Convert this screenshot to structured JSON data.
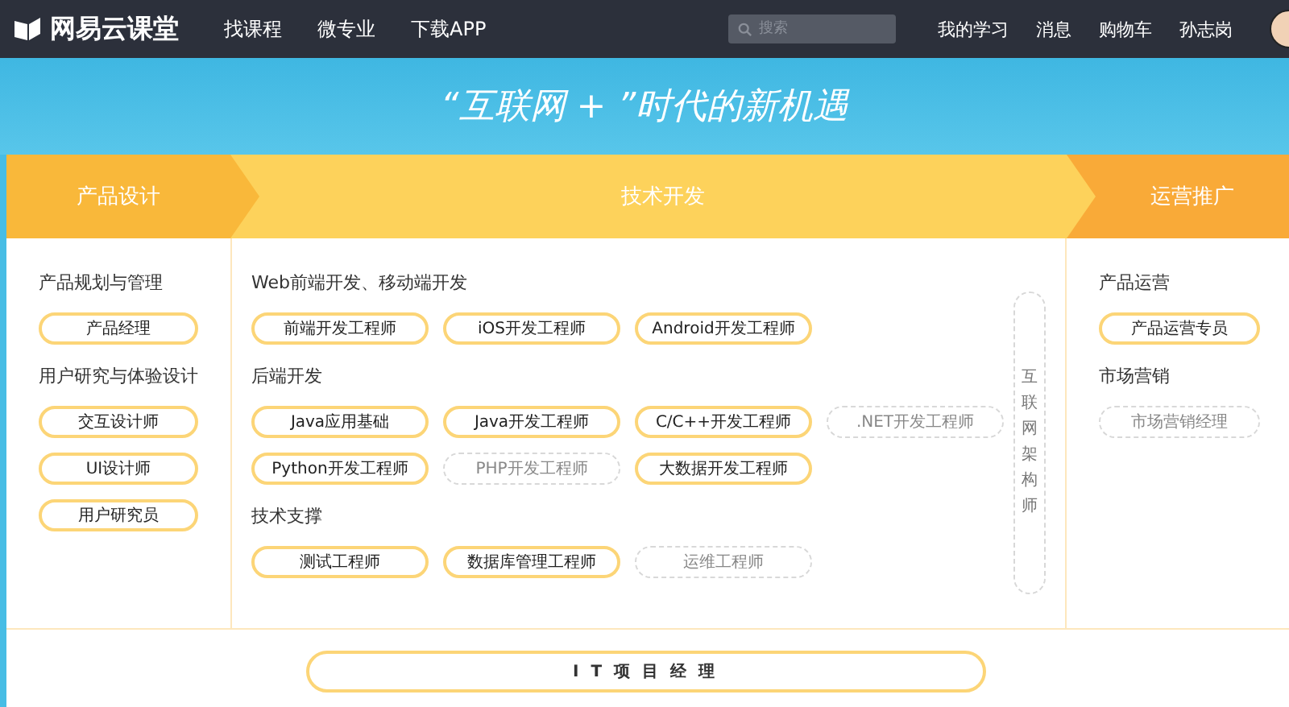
{
  "nav": {
    "logo": "网易云课堂",
    "links": [
      "找课程",
      "微专业",
      "下载APP"
    ],
    "search": {
      "placeholder": "搜索"
    },
    "user_links": [
      "我的学习",
      "消息",
      "购物车",
      "孙志岗"
    ]
  },
  "banner": {
    "title": "“互联网 + ”时代的新机遇"
  },
  "columns": [
    {
      "title": "产品设计",
      "groups": [
        {
          "title": "产品规划与管理",
          "chips": [
            {
              "label": "产品经理",
              "available": true
            }
          ]
        },
        {
          "title": "用户研究与体验设计",
          "chips": [
            {
              "label": "交互设计师",
              "available": true
            },
            {
              "label": "UI设计师",
              "available": true
            },
            {
              "label": "用户研究员",
              "available": true
            }
          ]
        }
      ]
    },
    {
      "title": "技术开发",
      "groups": [
        {
          "title": "Web前端开发、移动端开发",
          "chips": [
            {
              "label": "前端开发工程师",
              "available": true
            },
            {
              "label": "iOS开发工程师",
              "available": true
            },
            {
              "label": "Android开发工程师",
              "available": true
            }
          ]
        },
        {
          "title": "后端开发",
          "chips": [
            {
              "label": "Java应用基础",
              "available": true
            },
            {
              "label": "Java开发工程师",
              "available": true
            },
            {
              "label": "C/C++开发工程师",
              "available": true
            },
            {
              "label": ".NET开发工程师",
              "available": false
            },
            {
              "label": "Python开发工程师",
              "available": true
            },
            {
              "label": "PHP开发工程师",
              "available": false
            },
            {
              "label": "大数据开发工程师",
              "available": true
            }
          ]
        },
        {
          "title": "技术支撑",
          "chips": [
            {
              "label": "测试工程师",
              "available": true
            },
            {
              "label": "数据库管理工程师",
              "available": true
            },
            {
              "label": "运维工程师",
              "available": false
            }
          ]
        }
      ],
      "side_chip": {
        "label": "互联网架构师",
        "available": false
      }
    },
    {
      "title": "运营推广",
      "groups": [
        {
          "title": "产品运营",
          "chips": [
            {
              "label": "产品运营专员",
              "available": true
            }
          ]
        },
        {
          "title": "市场营销",
          "chips": [
            {
              "label": "市场营销经理",
              "available": false
            }
          ]
        }
      ]
    }
  ],
  "footer_chip": {
    "label": "I T 项 目 经 理",
    "available": true
  }
}
